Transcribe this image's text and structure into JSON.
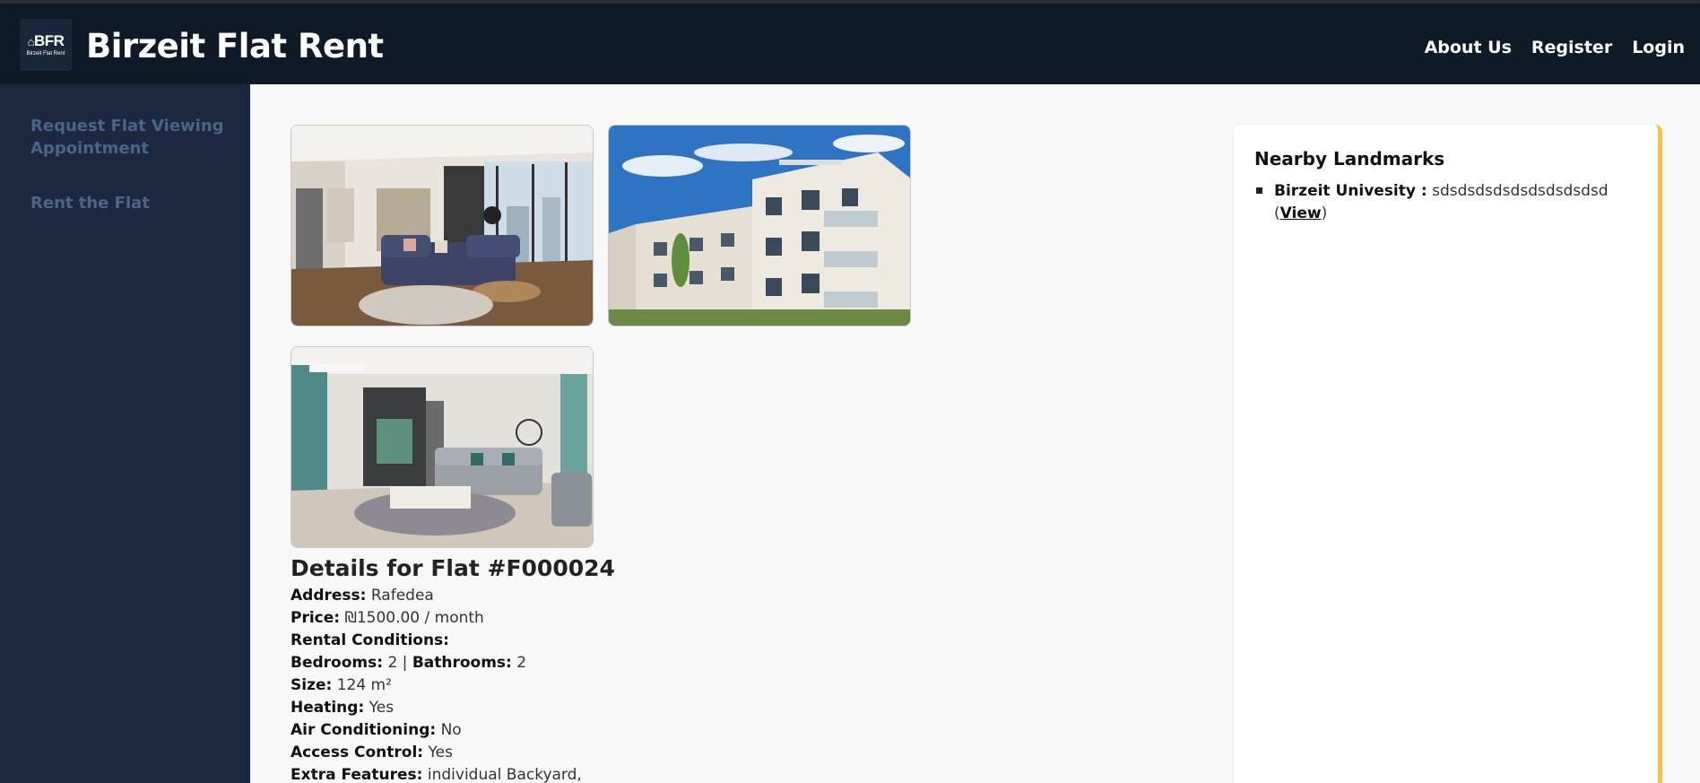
{
  "header": {
    "logo_text": "BFR",
    "logo_subtext": "Birzeit Flat Rent",
    "title": "Birzeit Flat Rent",
    "nav": [
      "About Us",
      "Register",
      "Login"
    ]
  },
  "sidebar": {
    "items": [
      {
        "label": "Request Flat Viewing Appointment"
      },
      {
        "label": "Rent the Flat"
      }
    ]
  },
  "photos": [
    {
      "alt": "living room with dark sofa and large windows"
    },
    {
      "alt": "modern white apartment building exterior"
    },
    {
      "alt": "living room with grey sofa and teal accents"
    }
  ],
  "details": {
    "heading": "Details for Flat #F000024",
    "address_label": "Address:",
    "address": "Rafedea",
    "price_label": "Price:",
    "price": "₪1500.00 / month",
    "rental_conditions_label": "Rental Conditions:",
    "bedrooms_label": "Bedrooms:",
    "bedrooms": "2",
    "separator": "|",
    "bathrooms_label": "Bathrooms:",
    "bathrooms": "2",
    "size_label": "Size:",
    "size": "124 m²",
    "heating_label": "Heating:",
    "heating": "Yes",
    "ac_label": "Air Conditioning:",
    "ac": "No",
    "access_label": "Access Control:",
    "access": "Yes",
    "extra_label": "Extra Features:",
    "extra": "individual Backyard,"
  },
  "landmarks": {
    "title": "Nearby Landmarks",
    "items": [
      {
        "name": "Birzeit Univesity :",
        "description": "sdsdsdsdsdsdsdsdsdsd",
        "open_paren": "(",
        "link": "View",
        "close_paren": ")"
      }
    ]
  },
  "colors": {
    "header_bg": "#0f1a29",
    "sidebar_bg": "#1c2840",
    "sidebar_text": "#4b6584",
    "accent": "#f2c34e"
  }
}
